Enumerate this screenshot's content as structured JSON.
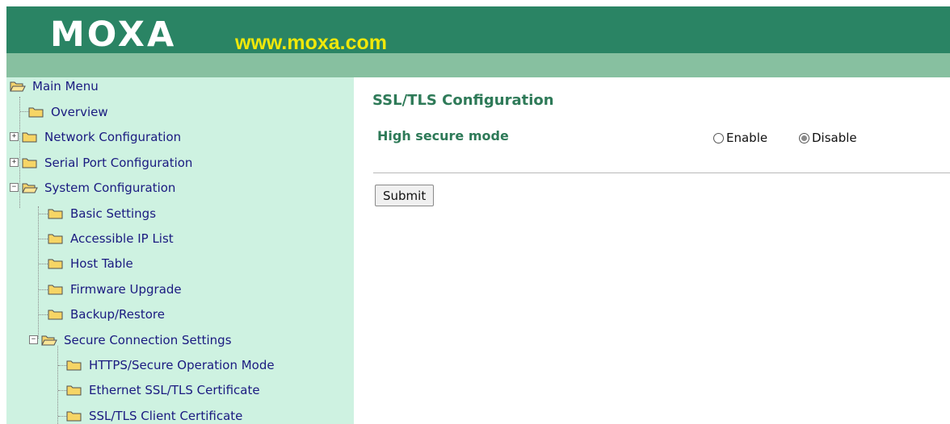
{
  "header": {
    "logo_text": "MOXA",
    "site_url": "www.moxa.com",
    "colors": {
      "dark_green": "#2a8464",
      "light_green": "#87c0a0",
      "url_yellow": "#f0e80a"
    }
  },
  "sidebar": {
    "background": "#cef2e1",
    "items": [
      {
        "label": "Main Menu",
        "icon": "open-folder-icon"
      },
      {
        "label": "Overview",
        "icon": "folder-icon"
      },
      {
        "label": "Network Configuration",
        "icon": "folder-icon",
        "expander": "+"
      },
      {
        "label": "Serial Port Configuration",
        "icon": "folder-icon",
        "expander": "+"
      },
      {
        "label": "System Configuration",
        "icon": "open-folder-icon",
        "expander": "−"
      },
      {
        "label": "Basic Settings",
        "icon": "folder-icon"
      },
      {
        "label": "Accessible IP List",
        "icon": "folder-icon"
      },
      {
        "label": "Host Table",
        "icon": "folder-icon"
      },
      {
        "label": "Firmware Upgrade",
        "icon": "folder-icon"
      },
      {
        "label": "Backup/Restore",
        "icon": "folder-icon"
      },
      {
        "label": "Secure Connection Settings",
        "icon": "open-folder-icon",
        "expander": "−"
      },
      {
        "label": "HTTPS/Secure Operation Mode",
        "icon": "folder-icon"
      },
      {
        "label": "Ethernet SSL/TLS Certificate",
        "icon": "folder-icon"
      },
      {
        "label": "SSL/TLS Client Certificate",
        "icon": "folder-icon"
      }
    ]
  },
  "main": {
    "title": "SSL/TLS Configuration",
    "field_label": "High secure mode",
    "options": [
      {
        "label": "Enable",
        "checked": false
      },
      {
        "label": "Disable",
        "checked": true
      }
    ],
    "submit_label": "Submit",
    "accent_color": "#2e7a58"
  }
}
